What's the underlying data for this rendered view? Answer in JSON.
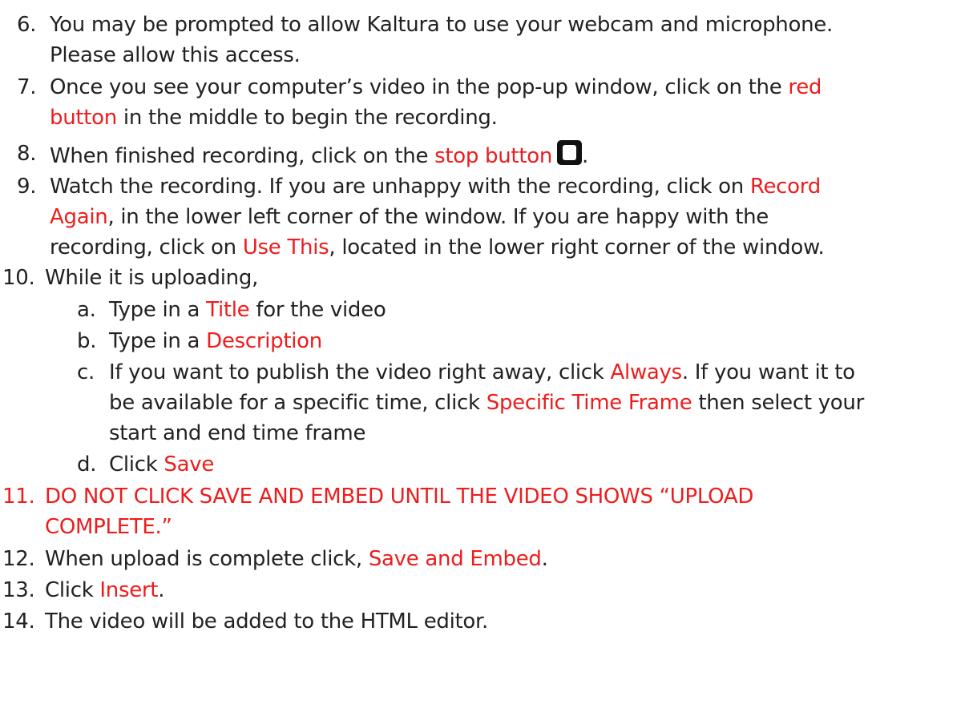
{
  "steps": {
    "s6": {
      "num": "6.",
      "l1": "You may be prompted to allow Kaltura to use your webcam and microphone.",
      "l2": "Please allow this access."
    },
    "s7": {
      "num": "7.",
      "l1a": "Once you see your computer’s video in the pop-up window, click on the ",
      "l1b": "red",
      "l2a": "button",
      "l2b": " in the middle to begin the recording."
    },
    "s8": {
      "num": "8.",
      "a": "When finished recording, click on the ",
      "b": "stop button",
      "icon": "stop-icon",
      "c": "."
    },
    "s9": {
      "num": "9.",
      "l1a": "Watch the recording.  If you are unhappy with the recording, click on ",
      "l1b": "Record",
      "l2a": "Again",
      "l2b": ", in the lower left corner of the window.  If you are happy with the",
      "l3a": "recording, click on ",
      "l3b": "Use This",
      "l3c": ", located in the lower right corner of the window."
    },
    "s10": {
      "num": "10.",
      "text": "While it is uploading,",
      "a": {
        "letter": "a.",
        "t1": "Type in a ",
        "t2": "Title",
        "t3": " for the video"
      },
      "b": {
        "letter": "b.",
        "t1": "Type in a ",
        "t2": "Description"
      },
      "c": {
        "letter": "c.",
        "l1a": "If you want to publish the video right away, click ",
        "l1b": "Always",
        "l1c": ".  If you want it to",
        "l2a": "be available for a specific time, click ",
        "l2b": "Specific Time Frame",
        "l2c": " then select your",
        "l3": "start and end time frame"
      },
      "d": {
        "letter": "d.",
        "t1": "Click ",
        "t2": "Save"
      }
    },
    "s11": {
      "num": "11.",
      "l1": "DO NOT CLICK SAVE AND EMBED UNTIL THE VIDEO SHOWS “UPLOAD",
      "l2": "COMPLETE.”"
    },
    "s12": {
      "num": "12.",
      "a": "When upload is complete click, ",
      "b": "Save and Embed",
      "c": "."
    },
    "s13": {
      "num": "13.",
      "a": "Click ",
      "b": "Insert",
      "c": "."
    },
    "s14": {
      "num": "14.",
      "a": "The video will be added to the HTML editor."
    }
  },
  "colors": {
    "text": "#222222",
    "highlight": "#ee1c1c"
  }
}
